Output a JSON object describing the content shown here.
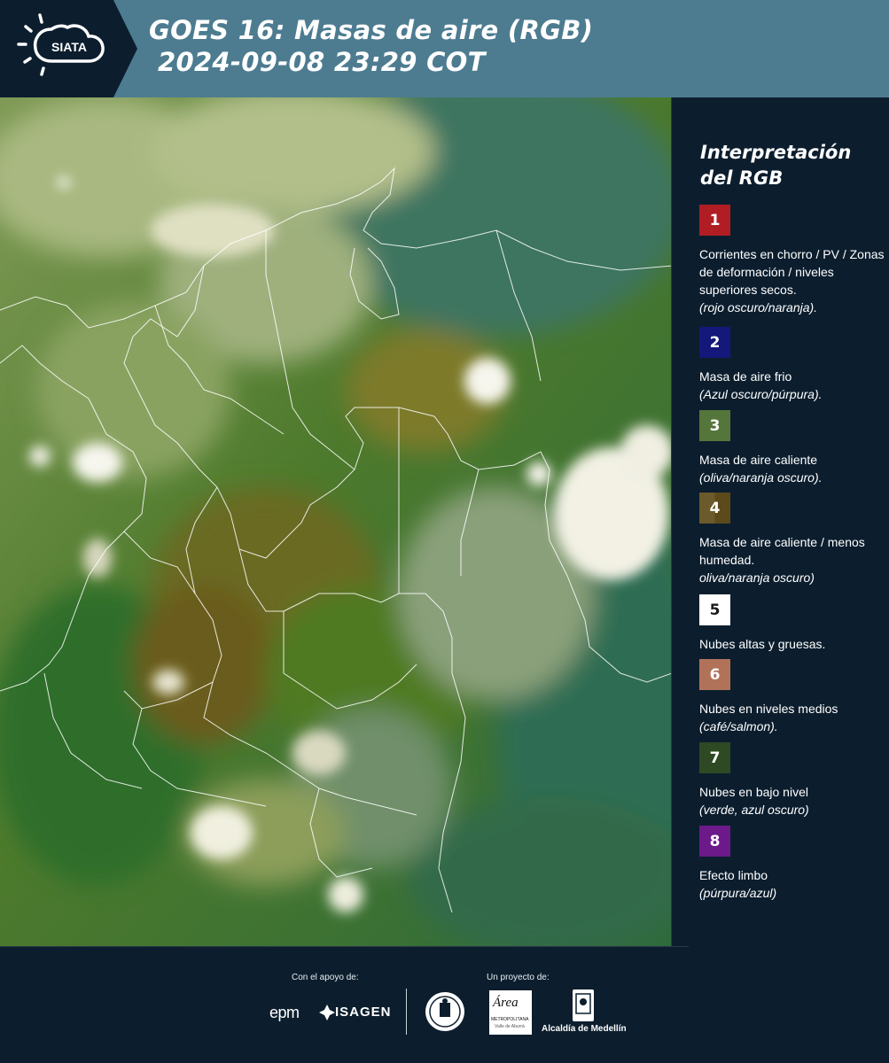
{
  "header": {
    "logo_text": "SIATA",
    "title_line1": "GOES 16: Masas de aire (RGB)",
    "title_line2": "2024-09-08 23:29 COT"
  },
  "legend": {
    "title_line1": "Interpretación",
    "title_line2": "del RGB",
    "items": [
      {
        "num": "1",
        "color": "#b01e23",
        "text": "Corrientes en chorro / PV / Zonas de deformación / niveles superiores secos.",
        "note": "(rojo oscuro/naranja)."
      },
      {
        "num": "2",
        "color": "#14187a",
        "text": "Masa de aire frio",
        "note": "(Azul oscuro/púrpura)."
      },
      {
        "num": "3",
        "color": "#55763a",
        "text": "Masa de aire caliente",
        "note": "(oliva/naranja oscuro)."
      },
      {
        "num": "4",
        "color": "#6b5a2c",
        "color2": "#5c4a1a",
        "text": "Masa de aire caliente / menos humedad.",
        "note": "oliva/naranja oscuro)"
      },
      {
        "num": "5",
        "color": "#ffffff",
        "text": "Nubes altas y gruesas.",
        "note": ""
      },
      {
        "num": "6",
        "color": "#b0735a",
        "text": "Nubes en niveles medios",
        "note": "(café/salmon)."
      },
      {
        "num": "7",
        "color": "#2d4a24",
        "text": "Nubes en bajo nivel",
        "note": "(verde, azul oscuro)"
      },
      {
        "num": "8",
        "color": "#6c1a8a",
        "text": "Efecto limbo",
        "note": "(púrpura/azul)"
      }
    ]
  },
  "footer": {
    "support_label": "Con el apoyo de:",
    "project_label": "Un proyecto de:",
    "epm_text": "epm",
    "isagen_text": "ISAGEN",
    "area_text": "Área",
    "area_sub": "METROPOLITANA",
    "area_sub2": "Valle de Aburrá",
    "alcaldia_text": "Alcaldía de Medellín"
  }
}
